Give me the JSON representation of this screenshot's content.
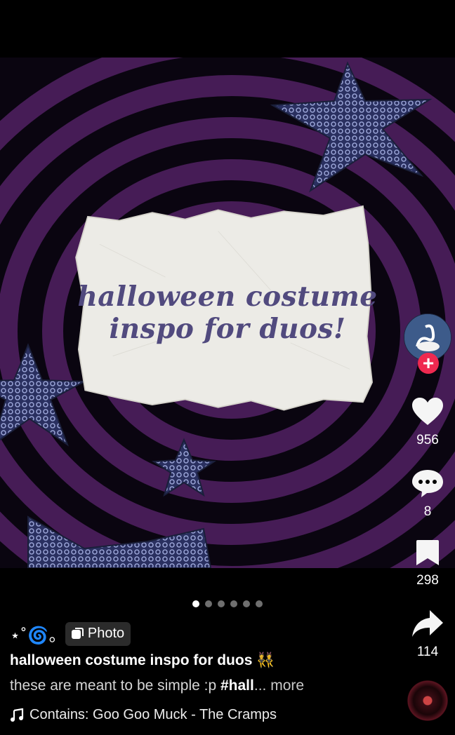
{
  "art": {
    "headline_line1": "halloween costume",
    "headline_line2": "inspo for duos!"
  },
  "actions": {
    "likes": "956",
    "comments": "8",
    "saves": "298",
    "shares": "114"
  },
  "carousel": {
    "total": 6,
    "active_index": 0
  },
  "post": {
    "handle": "⋆˚🌀｡",
    "badge_label": "Photo",
    "title": "halloween costume inspo for duos 👯",
    "description_text": "these are meant to be simple :p ",
    "description_hashtag": "#hall",
    "description_more": "... more",
    "music": "Contains: Goo Goo Muck - The Cramps"
  },
  "colors": {
    "spiral_purple": "#4a1e5a",
    "star_navy": "#2b3159",
    "headline": "#514a7e",
    "follow_red": "#ef2950"
  }
}
